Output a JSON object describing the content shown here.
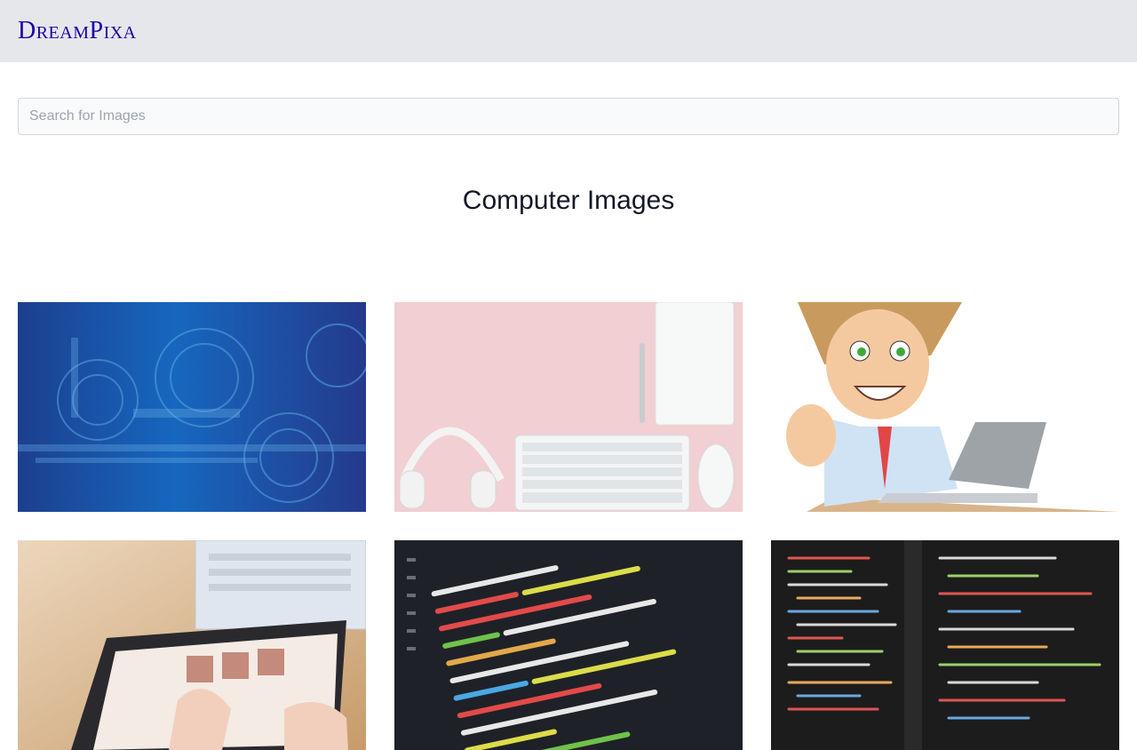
{
  "header": {
    "brand": "DreamPixa"
  },
  "search": {
    "placeholder": "Search for Images",
    "value": ""
  },
  "main": {
    "heading": "Computer Images",
    "images": [
      {
        "icon": "circuit-gears-image",
        "color": "#1e4fa0"
      },
      {
        "icon": "desk-headphones-keyboard-image",
        "color": "#f0cfd1"
      },
      {
        "icon": "cartoon-man-laptop-image",
        "color": "#ffffff"
      },
      {
        "icon": "tablet-hands-image",
        "color": "#e8d4be"
      },
      {
        "icon": "code-screen-image",
        "color": "#20222a"
      },
      {
        "icon": "code-editor-image",
        "color": "#1c1c1c"
      }
    ]
  }
}
